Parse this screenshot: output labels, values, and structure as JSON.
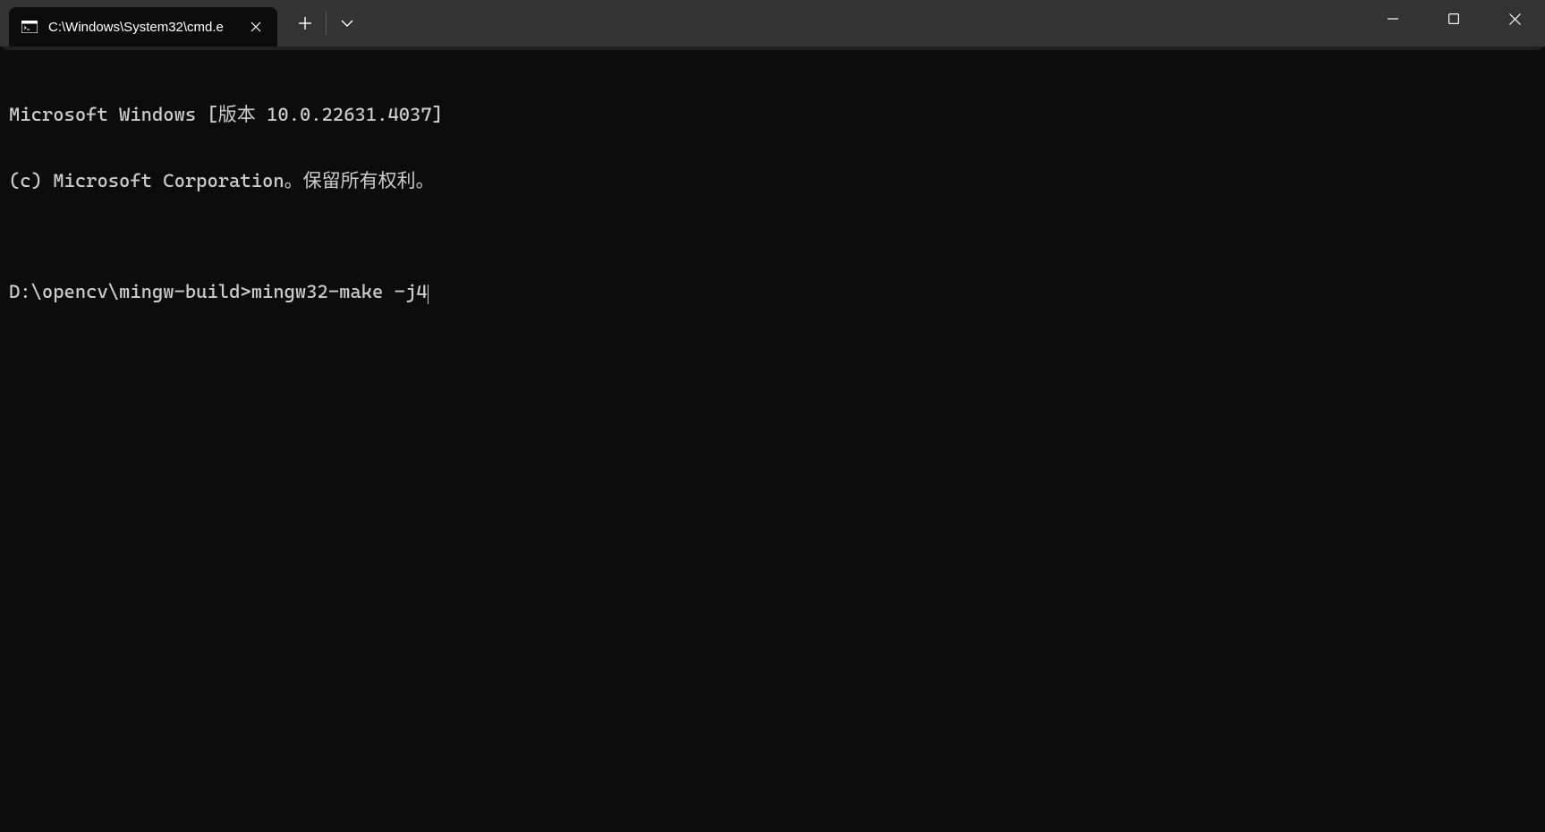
{
  "tab": {
    "title": "C:\\Windows\\System32\\cmd.e"
  },
  "terminal": {
    "line1": "Microsoft Windows [版本 10.0.22631.4037]",
    "line2": "(c) Microsoft Corporation。保留所有权利。",
    "blank": "",
    "prompt": "D:\\opencv\\mingw-build>",
    "command": "mingw32-make -j4"
  }
}
